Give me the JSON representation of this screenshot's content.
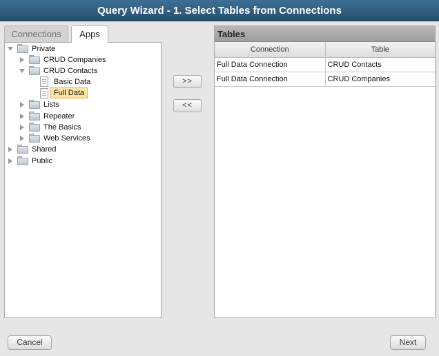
{
  "window": {
    "title": "Query Wizard - 1. Select Tables from Connections"
  },
  "tabs": [
    {
      "label": "Connections",
      "active": false
    },
    {
      "label": "Apps",
      "active": true
    }
  ],
  "tree": {
    "private": "Private",
    "crud_companies": "CRUD Companies",
    "crud_contacts": "CRUD Contacts",
    "basic_data": "Basic Data",
    "full_data": "Full Data",
    "lists": "Lists",
    "repeater": "Repeater",
    "the_basics": "The Basics",
    "web_services": "Web Services",
    "shared": "Shared",
    "public": "Public"
  },
  "transfer": {
    "add_label": ">>",
    "remove_label": "<<"
  },
  "tables_panel": {
    "title": "Tables",
    "columns": [
      "Connection",
      "Table"
    ],
    "rows": [
      [
        "Full Data Connection",
        "CRUD Contacts"
      ],
      [
        "Full Data Connection",
        "CRUD Companies"
      ]
    ]
  },
  "footer": {
    "cancel_label": "Cancel",
    "next_label": "Next"
  },
  "colors": {
    "title_bar": "#2d5878",
    "selection_fill": "#fde3a3",
    "selection_border": "#e4b04c"
  }
}
